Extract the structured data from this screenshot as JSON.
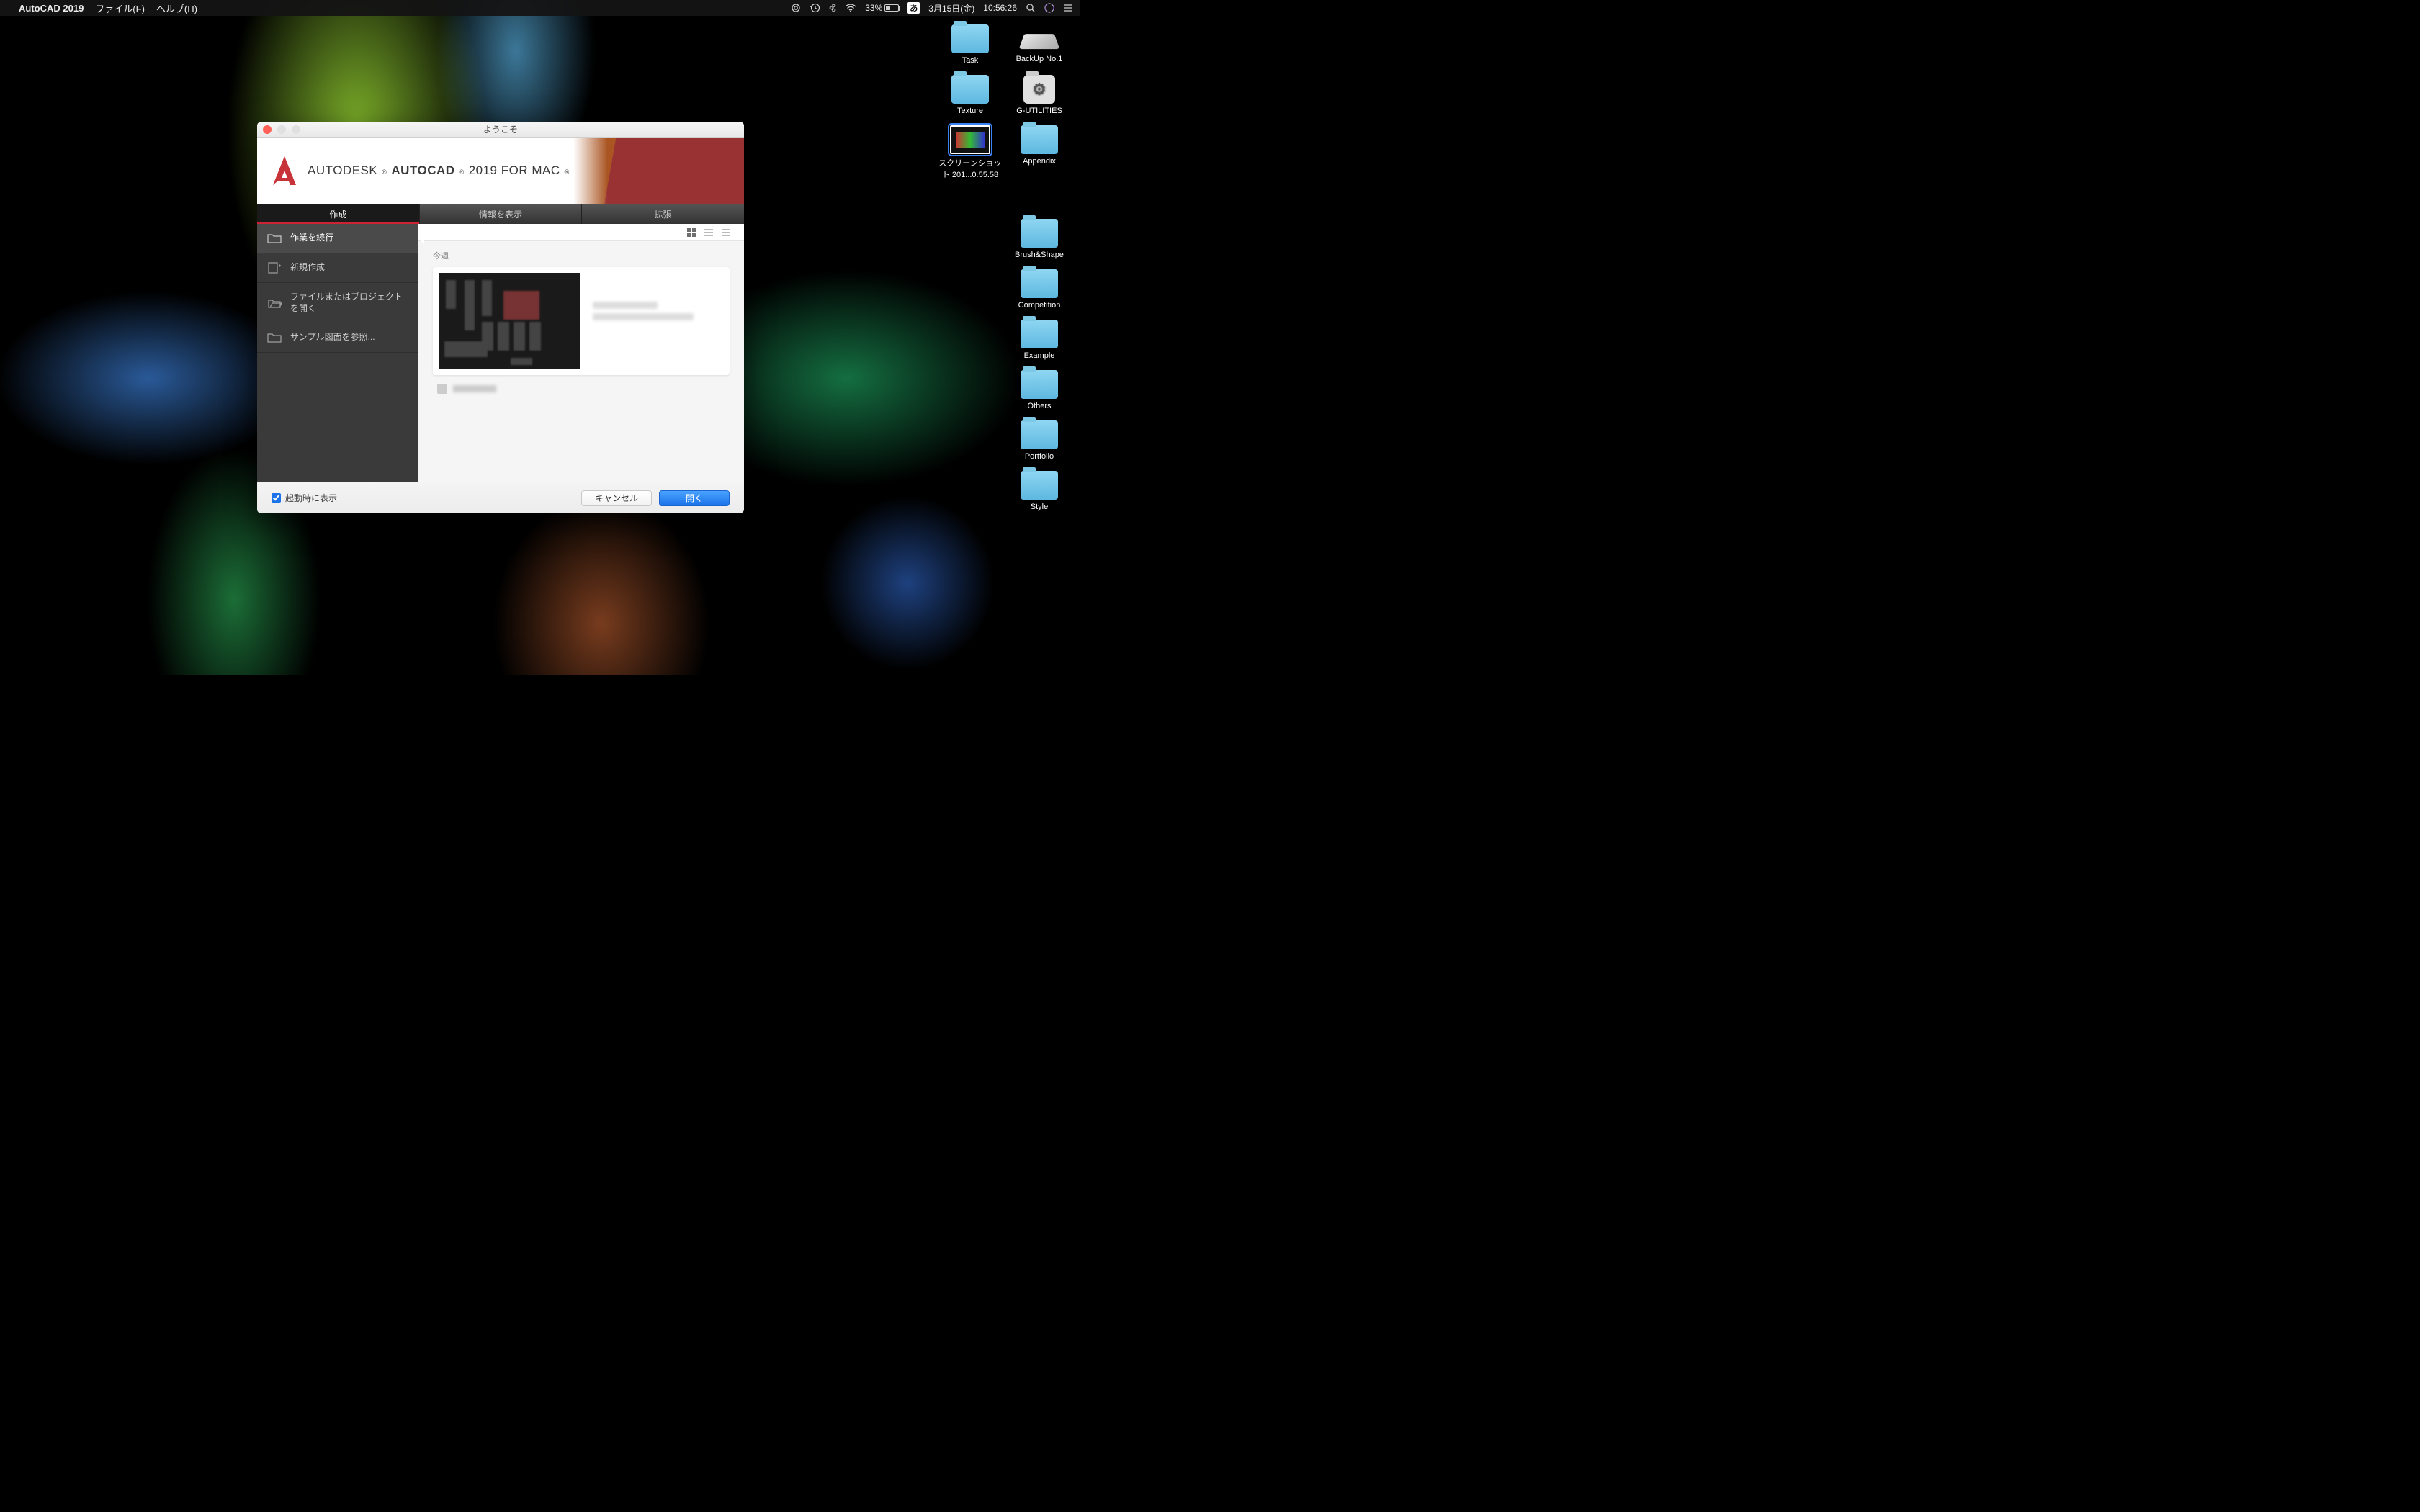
{
  "menubar": {
    "app_name": "AutoCAD 2019",
    "menus": [
      "ファイル(F)",
      "ヘルプ(H)"
    ],
    "battery_pct": "33%",
    "ime": "あ",
    "date": "3月15日(金)",
    "time": "10:56:26"
  },
  "desktop": {
    "row1": [
      {
        "label": "Task",
        "kind": "folder"
      },
      {
        "label": "BackUp No.1",
        "kind": "disk"
      }
    ],
    "row2": [
      {
        "label": "Texture",
        "kind": "folder"
      },
      {
        "label": "G-UTILITIES",
        "kind": "util"
      }
    ],
    "row3": [
      {
        "label": "スクリーンショット 201...0.55.58",
        "kind": "screenshot"
      },
      {
        "label": "Appendix",
        "kind": "folder"
      }
    ],
    "col": [
      {
        "label": "Brush&Shape"
      },
      {
        "label": "Competition"
      },
      {
        "label": "Example"
      },
      {
        "label": "Others"
      },
      {
        "label": "Portfolio"
      },
      {
        "label": "Style"
      }
    ]
  },
  "dialog": {
    "title": "ようこそ",
    "brand": {
      "company": "AUTODESK",
      "product": "AUTOCAD",
      "suffix": "2019 FOR MAC"
    },
    "tabs": [
      "作成",
      "情報を表示",
      "拡張"
    ],
    "sidebar": [
      {
        "label": "作業を続行",
        "icon": "folder"
      },
      {
        "label": "新規作成",
        "icon": "new"
      },
      {
        "label": "ファイルまたはプロジェクトを開く",
        "icon": "open"
      },
      {
        "label": "サンプル図面を参照...",
        "icon": "sample"
      }
    ],
    "content": {
      "time_heading": "今週"
    },
    "footer": {
      "startup_label": "起動時に表示",
      "cancel": "キャンセル",
      "open": "開く"
    }
  }
}
